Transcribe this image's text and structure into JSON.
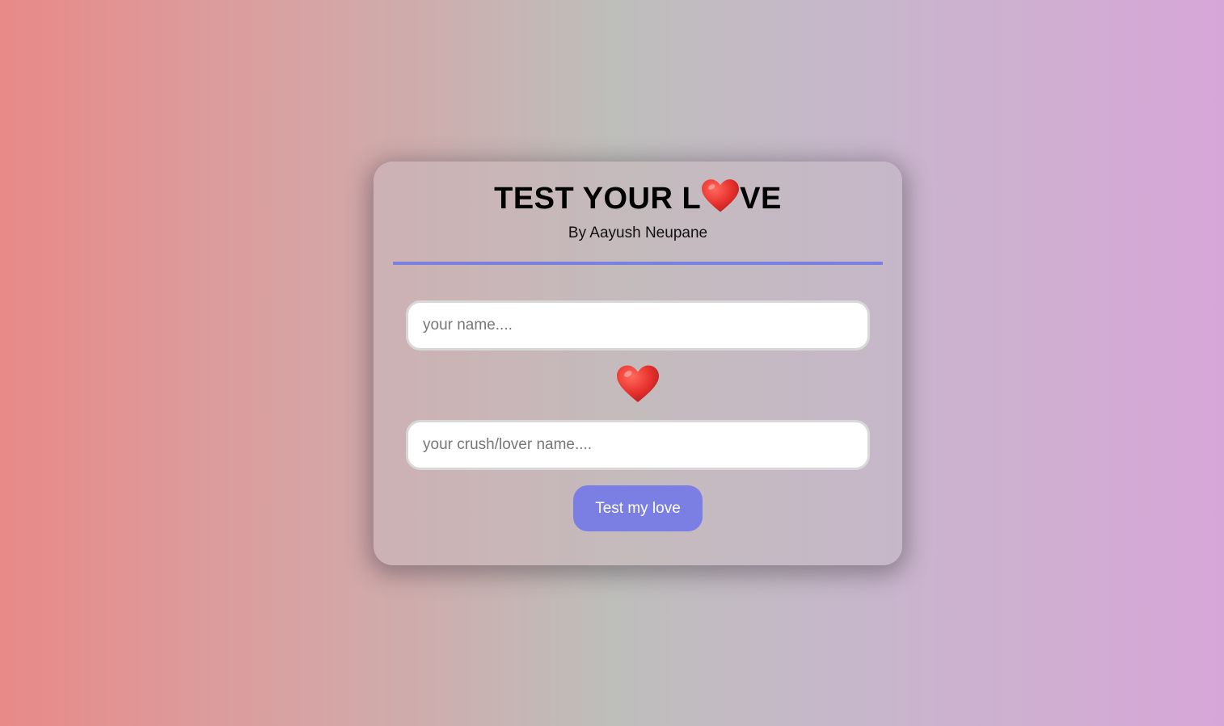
{
  "header": {
    "title_prefix": "TEST YOUR L",
    "title_suffix": "VE",
    "subtitle": "By Aayush Neupane"
  },
  "form": {
    "name_placeholder": "your name....",
    "name_value": "",
    "crush_placeholder": "your crush/lover name....",
    "crush_value": "",
    "submit_label": "Test my love"
  },
  "icons": {
    "title_heart": "heart-icon",
    "middle_heart": "heart-icon"
  },
  "colors": {
    "accent": "#7b7fe3",
    "heart": "#e8322e",
    "divider": "#7b80e0"
  }
}
